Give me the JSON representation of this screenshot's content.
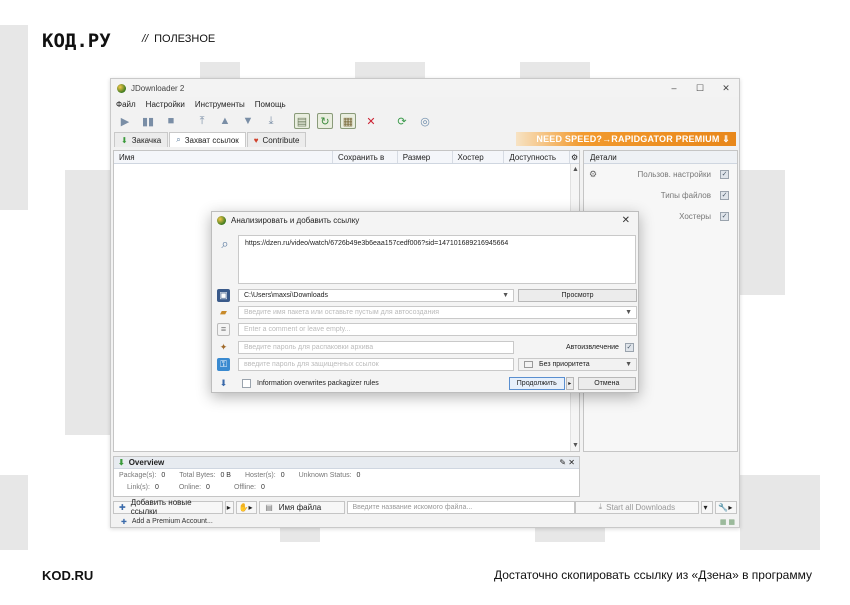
{
  "header": {
    "logo": "КОД.РУ",
    "crumb_sep": "//",
    "crumb": "ПОЛЕЗНОЕ"
  },
  "footer": {
    "left": "KOD.RU",
    "right": "Достаточно скопировать ссылку из «Дзена» в программу"
  },
  "window": {
    "title": "JDownloader 2",
    "controls": [
      "–",
      "☐",
      "✕"
    ],
    "menu": [
      "Файл",
      "Настройки",
      "Инструменты",
      "Помощь"
    ],
    "tabs": [
      {
        "label": "Закачка",
        "icon": "download-tab-icon"
      },
      {
        "label": "Захват ссылок",
        "icon": "linkgrabber-tab-icon"
      },
      {
        "label": "Contribute",
        "icon": "heart-icon"
      }
    ],
    "banner": "NEED SPEED?→RAPIDGATOR PREMIUM ⇓",
    "columns": [
      "Имя",
      "Сохранить в",
      "Размер",
      "Хостер",
      "Доступность"
    ],
    "details": {
      "title": "Детали",
      "rows": [
        "Пользов. настройки",
        "Типы файлов",
        "Хостеры"
      ]
    },
    "overview": {
      "title": "Overview",
      "line1": [
        {
          "k": "Package(s):",
          "v": "0"
        },
        {
          "k": "Total Bytes:",
          "v": "0 B"
        },
        {
          "k": "Hoster(s):",
          "v": "0"
        },
        {
          "k": "Unknown Status:",
          "v": "0"
        }
      ],
      "line2": [
        {
          "k": "Link(s):",
          "v": "0"
        },
        {
          "k": "Online:",
          "v": "0"
        },
        {
          "k": "Offline:",
          "v": "0"
        }
      ]
    },
    "bottom": {
      "add_links": "Добавить новые ссылки",
      "filename_label": "Имя файла",
      "search_placeholder": "Введите название искомого файла...",
      "start_all": "Start all Downloads"
    },
    "status": {
      "add_premium": "Add a Premium Account..."
    }
  },
  "dialog": {
    "title": "Анализировать и добавить ссылку",
    "url": "https://dzen.ru/video/watch/6726b49e3b6eaa157cedf006?sid=147101689216945664",
    "save_path": "C:\\Users\\maxsi\\Downloads",
    "browse": "Просмотр",
    "package_placeholder": "Введите имя пакета или оставьте пустым для автосоздания",
    "comment_placeholder": "Enter a comment or leave empty...",
    "archive_pw_placeholder": "Введите пароль для распаковки архива",
    "autoextract": "Автоизвлечение",
    "link_pw_placeholder": "введите пароль для защищенных ссылок",
    "priority": "Без приоритета",
    "overwrite": "Information overwrites packagizer rules",
    "continue": "Продолжить",
    "cancel": "Отмена"
  }
}
